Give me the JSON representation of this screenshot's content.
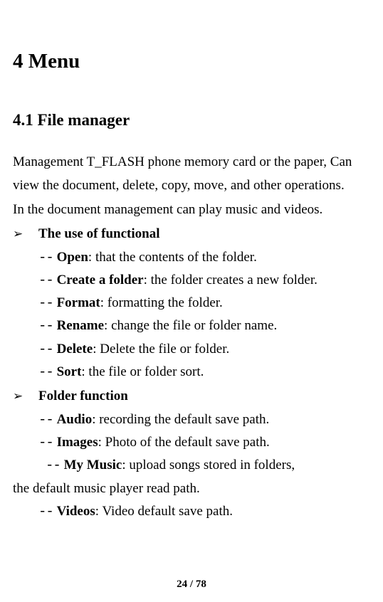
{
  "heading1": "4 Menu",
  "heading2": "4.1 File manager",
  "intro_p1": "Management T_FLASH phone memory card or the paper, Can view the document, delete, copy, move, and other operations.",
  "intro_p2": "In the document management can play music and videos.",
  "bullet_arrow": "➢",
  "dash_prefix": "--",
  "section1": {
    "title": "The use of functional",
    "items": [
      {
        "term": "Open",
        "colon": ":",
        "desc": " that the contents of the folder."
      },
      {
        "term": "Create a folder",
        "colon": ":",
        "desc": " the folder creates a new folder."
      },
      {
        "term": "Format",
        "colon": ":",
        "desc": " formatting the folder."
      },
      {
        "term": "Rename",
        "colon": ":",
        "desc": " change the file or folder name."
      },
      {
        "term": "Delete",
        "colon": ":",
        "desc": " Delete the file or folder."
      },
      {
        "term": "Sort",
        "colon": ":",
        "desc": " the file or folder sort."
      }
    ]
  },
  "section2": {
    "title": "Folder function",
    "items": [
      {
        "term": "Audio",
        "colon": ":",
        "desc": " recording the default save path."
      },
      {
        "term": "Images",
        "colon": ":",
        "desc": " Photo of the default save path."
      }
    ],
    "mymusic_line": {
      "term": "My Music",
      "colon": ":",
      "desc": " upload songs stored in folders, the default music player read path."
    },
    "videos_line": {
      "term": "Videos",
      "colon": ":",
      "desc": " Video default save path."
    }
  },
  "page_number": "24 / 78"
}
